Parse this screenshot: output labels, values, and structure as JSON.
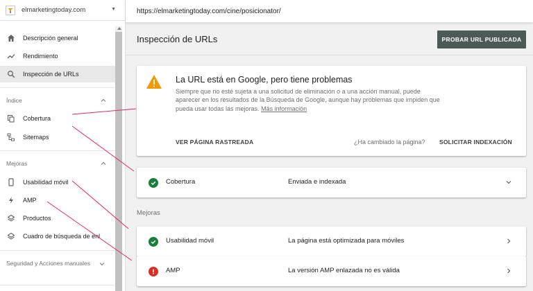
{
  "sidebar": {
    "property_name": "elmarketingtoday.com",
    "main_items": [
      {
        "label": "Descripción general",
        "icon": "home-icon"
      },
      {
        "label": "Rendimiento",
        "icon": "trend-icon"
      },
      {
        "label": "Inspección de URLs",
        "icon": "search-icon",
        "active": true
      }
    ],
    "index_section": {
      "label": "Índice",
      "items": [
        {
          "label": "Cobertura",
          "icon": "copy-icon"
        },
        {
          "label": "Sitemaps",
          "icon": "sitemap-icon"
        }
      ]
    },
    "enhancements_section": {
      "label": "Mejoras",
      "items": [
        {
          "label": "Usabilidad móvil",
          "icon": "phone-icon"
        },
        {
          "label": "AMP",
          "icon": "bolt-icon"
        },
        {
          "label": "Productos",
          "icon": "layers-icon"
        },
        {
          "label": "Cuadro de búsqueda de enl",
          "icon": "layers-icon"
        }
      ]
    },
    "security_section": {
      "label": "Seguridad y Acciones manuales"
    }
  },
  "urlbar": {
    "url": "https://elmarketingtoday.com/cine/posicionator/"
  },
  "header": {
    "title": "Inspección de URLs",
    "test_button": "PROBAR URL PUBLICADA"
  },
  "status_card": {
    "title": "La URL está en Google, pero tiene problemas",
    "description": "Siempre que no esté sujeta a una solicitud de eliminación o a una acción manual, puede aparecer en los resultados de la Búsqueda de Google, aunque hay problemas que impiden que pueda usar todas las mejoras.",
    "more_link": "Más información",
    "view_crawled": "VER PÁGINA RASTREADA",
    "changed_question": "¿Ha cambiado la página?",
    "request_indexing": "SOLICITAR INDEXACIÓN"
  },
  "coverage_row": {
    "name": "Cobertura",
    "status": "Enviada e indexada"
  },
  "enhancements": {
    "label": "Mejoras",
    "rows": [
      {
        "name": "Usabilidad móvil",
        "status": "La página está optimizada para móviles",
        "state": "valid"
      },
      {
        "name": "AMP",
        "status": "La versión AMP enlazada no es válida",
        "state": "error"
      }
    ]
  },
  "colors": {
    "valid": "#188038",
    "error": "#d93025",
    "warning": "#f29900",
    "button_bg": "#4b5a56",
    "annotation_line": "#e8275c"
  }
}
